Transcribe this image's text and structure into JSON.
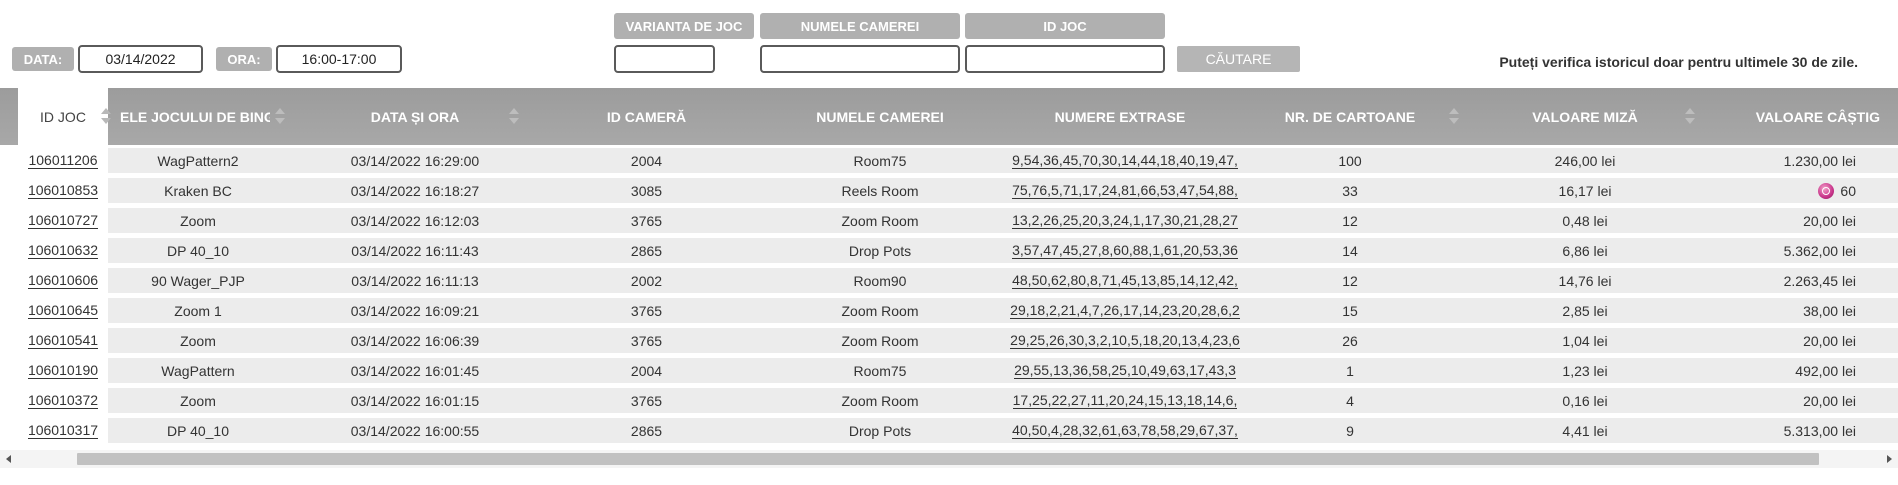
{
  "filters": {
    "date_label": "DATA:",
    "date_value": "03/14/2022",
    "time_label": "ORA:",
    "time_value": "16:00-17:00",
    "variant_label": "VARIANTA DE JOC",
    "variant_value": "",
    "room_label": "NUMELE CAMEREI",
    "room_value": "",
    "id_label": "ID JOC",
    "id_value": "",
    "search_label": "CĂUTARE"
  },
  "note": "Puteți verifica istoricul doar pentru ultimele 30 de zile.",
  "table": {
    "headers": {
      "id": "ID JOC",
      "game": "ELE JOCULUI DE BINGO",
      "datetime": "DATA ȘI ORA",
      "room_id": "ID CAMERĂ",
      "room_name": "NUMELE CAMEREI",
      "numbers": "NUMERE EXTRASE",
      "cards": "NR. DE CARTOANE",
      "bet": "VALOARE MIZĂ",
      "win": "VALOARE CÂȘTIG"
    },
    "rows": [
      {
        "id": "106011206",
        "game": "WagPattern2",
        "datetime": "03/14/2022 16:29:00",
        "room_id": "2004",
        "room_name": "Room75",
        "numbers": "9,54,36,45,70,30,14,44,18,40,19,47,",
        "cards": "100",
        "bet": "246,00 lei",
        "win": "1.230,00 lei"
      },
      {
        "id": "106010853",
        "game": "Kraken BC",
        "datetime": "03/14/2022 16:18:27",
        "room_id": "3085",
        "room_name": "Reels Room",
        "numbers": "75,76,5,71,17,24,81,66,53,47,54,88,",
        "cards": "33",
        "bet": "16,17 lei",
        "win": "60",
        "win_icon": "bonus-coin-icon"
      },
      {
        "id": "106010727",
        "game": "Zoom",
        "datetime": "03/14/2022 16:12:03",
        "room_id": "3765",
        "room_name": "Zoom Room",
        "numbers": "13,2,26,25,20,3,24,1,17,30,21,28,27",
        "cards": "12",
        "bet": "0,48 lei",
        "win": "20,00 lei"
      },
      {
        "id": "106010632",
        "game": "DP 40_10",
        "datetime": "03/14/2022 16:11:43",
        "room_id": "2865",
        "room_name": "Drop Pots",
        "numbers": "3,57,47,45,27,8,60,88,1,61,20,53,36",
        "cards": "14",
        "bet": "6,86 lei",
        "win": "5.362,00 lei"
      },
      {
        "id": "106010606",
        "game": "90 Wager_PJP",
        "datetime": "03/14/2022 16:11:13",
        "room_id": "2002",
        "room_name": "Room90",
        "numbers": "48,50,62,80,8,71,45,13,85,14,12,42,",
        "cards": "12",
        "bet": "14,76 lei",
        "win": "2.263,45 lei"
      },
      {
        "id": "106010645",
        "game": "Zoom 1",
        "datetime": "03/14/2022 16:09:21",
        "room_id": "3765",
        "room_name": "Zoom Room",
        "numbers": "29,18,2,21,4,7,26,17,14,23,20,28,6,2",
        "cards": "15",
        "bet": "2,85 lei",
        "win": "38,00 lei"
      },
      {
        "id": "106010541",
        "game": "Zoom",
        "datetime": "03/14/2022 16:06:39",
        "room_id": "3765",
        "room_name": "Zoom Room",
        "numbers": "29,25,26,30,3,2,10,5,18,20,13,4,23,6",
        "cards": "26",
        "bet": "1,04 lei",
        "win": "20,00 lei"
      },
      {
        "id": "106010190",
        "game": "WagPattern",
        "datetime": "03/14/2022 16:01:45",
        "room_id": "2004",
        "room_name": "Room75",
        "numbers": "29,55,13,36,58,25,10,49,63,17,43,3",
        "cards": "1",
        "bet": "1,23 lei",
        "win": "492,00 lei"
      },
      {
        "id": "106010372",
        "game": "Zoom",
        "datetime": "03/14/2022 16:01:15",
        "room_id": "3765",
        "room_name": "Zoom Room",
        "numbers": "17,25,22,27,11,20,24,15,13,18,14,6,",
        "cards": "4",
        "bet": "0,16 lei",
        "win": "20,00 lei"
      },
      {
        "id": "106010317",
        "game": "DP 40_10",
        "datetime": "03/14/2022 16:00:55",
        "room_id": "2865",
        "room_name": "Drop Pots",
        "numbers": "40,50,4,28,32,61,63,78,58,29,67,37,",
        "cards": "9",
        "bet": "4,41 lei",
        "win": "5.313,00 lei"
      }
    ]
  }
}
